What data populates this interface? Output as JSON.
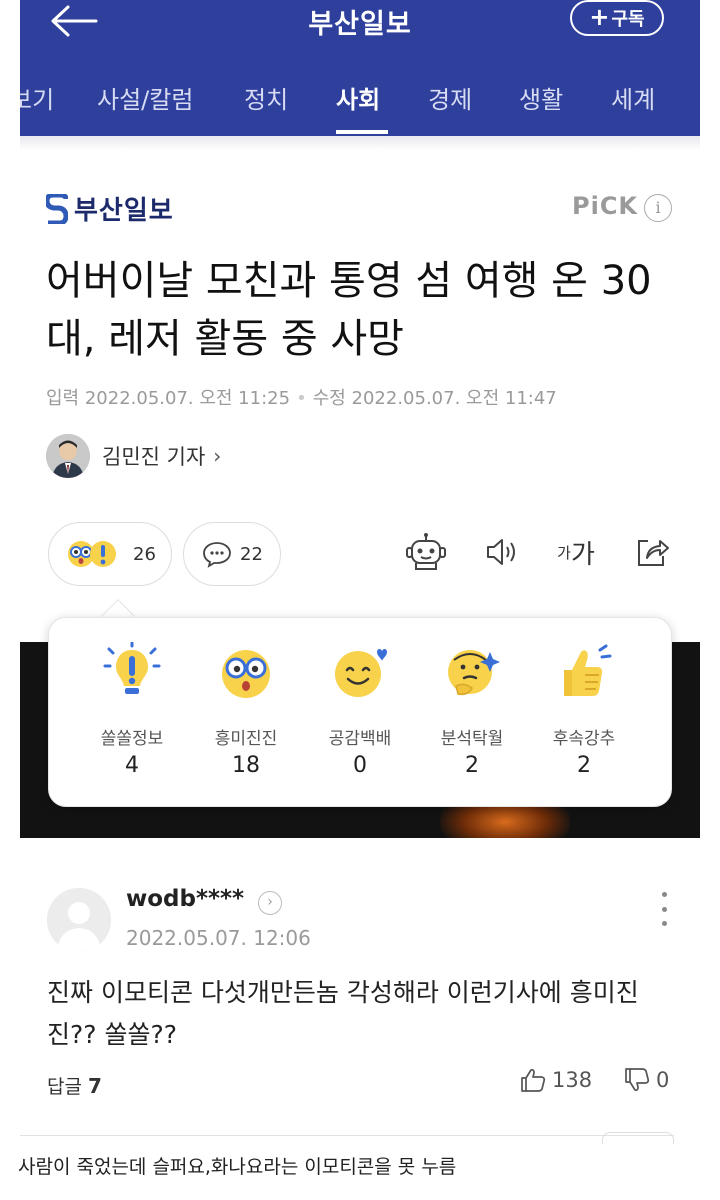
{
  "app": {
    "title": "부산일보",
    "subscribe_label": "구독",
    "tabs": [
      {
        "label": "보기"
      },
      {
        "label": "사설/칼럼"
      },
      {
        "label": "정치"
      },
      {
        "label": "사회"
      },
      {
        "label": "경제"
      },
      {
        "label": "생활"
      },
      {
        "label": "세계"
      }
    ],
    "active_tab": "사회",
    "accent_color": "#2f3f9c"
  },
  "article": {
    "publisher": "부산일보",
    "pick_label": "PiCK",
    "headline": "어버이날 모친과 통영 섬 여행 온 30대, 레저 활동 중 사망",
    "published": "입력 2022.05.07. 오전 11:25",
    "modified": "수정 2022.05.07. 오전 11:47",
    "reporter": "김민진 기자"
  },
  "actions": {
    "reaction_count": "26",
    "comment_count": "22",
    "fontsize_small": "가",
    "fontsize_large": "가"
  },
  "reactions": [
    {
      "label": "쏠쏠정보",
      "count": "4",
      "icon": "lightbulb-emoji-icon"
    },
    {
      "label": "흥미진진",
      "count": "18",
      "icon": "glasses-emoji-icon"
    },
    {
      "label": "공감백배",
      "count": "0",
      "icon": "heart-smile-emoji-icon"
    },
    {
      "label": "분석탁월",
      "count": "2",
      "icon": "thinking-emoji-icon"
    },
    {
      "label": "후속강추",
      "count": "2",
      "icon": "thumbs-up-emoji-icon"
    }
  ],
  "comment": {
    "user": "wodb****",
    "time": "2022.05.07. 12:06",
    "body": "진짜 이모티콘 다섯개만든놈 각성해라 이런기사에 흥미진진?? 쏠쏠??",
    "replies_label": "답글",
    "replies_count": "7",
    "likes": "138",
    "dislikes": "0"
  },
  "caption": "사람이 죽었는데 슬퍼요,화나요라는 이모티콘을 못 누름"
}
